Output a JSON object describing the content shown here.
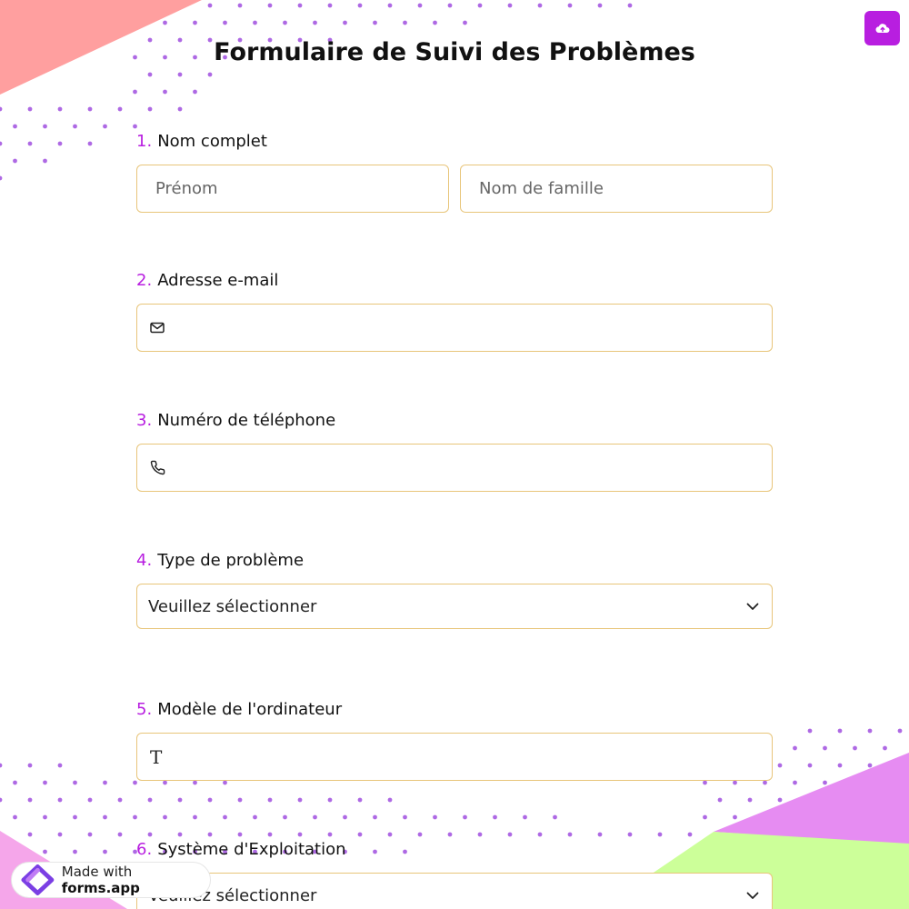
{
  "form": {
    "title": "Formulaire de Suivi des Problèmes",
    "questions": [
      {
        "number": "1.",
        "label": "Nom complet",
        "first_placeholder": "Prénom",
        "last_placeholder": "Nom de famille"
      },
      {
        "number": "2.",
        "label": "Adresse e-mail",
        "icon": "envelope-icon"
      },
      {
        "number": "3.",
        "label": "Numéro de téléphone",
        "icon": "phone-icon"
      },
      {
        "number": "4.",
        "label": "Type de problème",
        "selected": "Veuillez sélectionner"
      },
      {
        "number": "5.",
        "label": "Modèle de l'ordinateur",
        "icon": "text-type-icon",
        "icon_glyph": "T"
      },
      {
        "number": "6.",
        "label": "Système d'Exploitation",
        "selected": "Veuillez sélectionner"
      }
    ]
  },
  "toolbar": {
    "upload_icon": "cloud-upload-icon"
  },
  "branding": {
    "made_with": "Made with",
    "brand": "forms.app"
  },
  "colors": {
    "accent": "#b81ee0",
    "field_border": "#e8c57a",
    "shape_coral": "#ff9f9f",
    "shape_pink": "#f5a6ea",
    "shape_violet": "#e68cf2",
    "shape_lime": "#ccff99",
    "dots": "#a050e0"
  }
}
